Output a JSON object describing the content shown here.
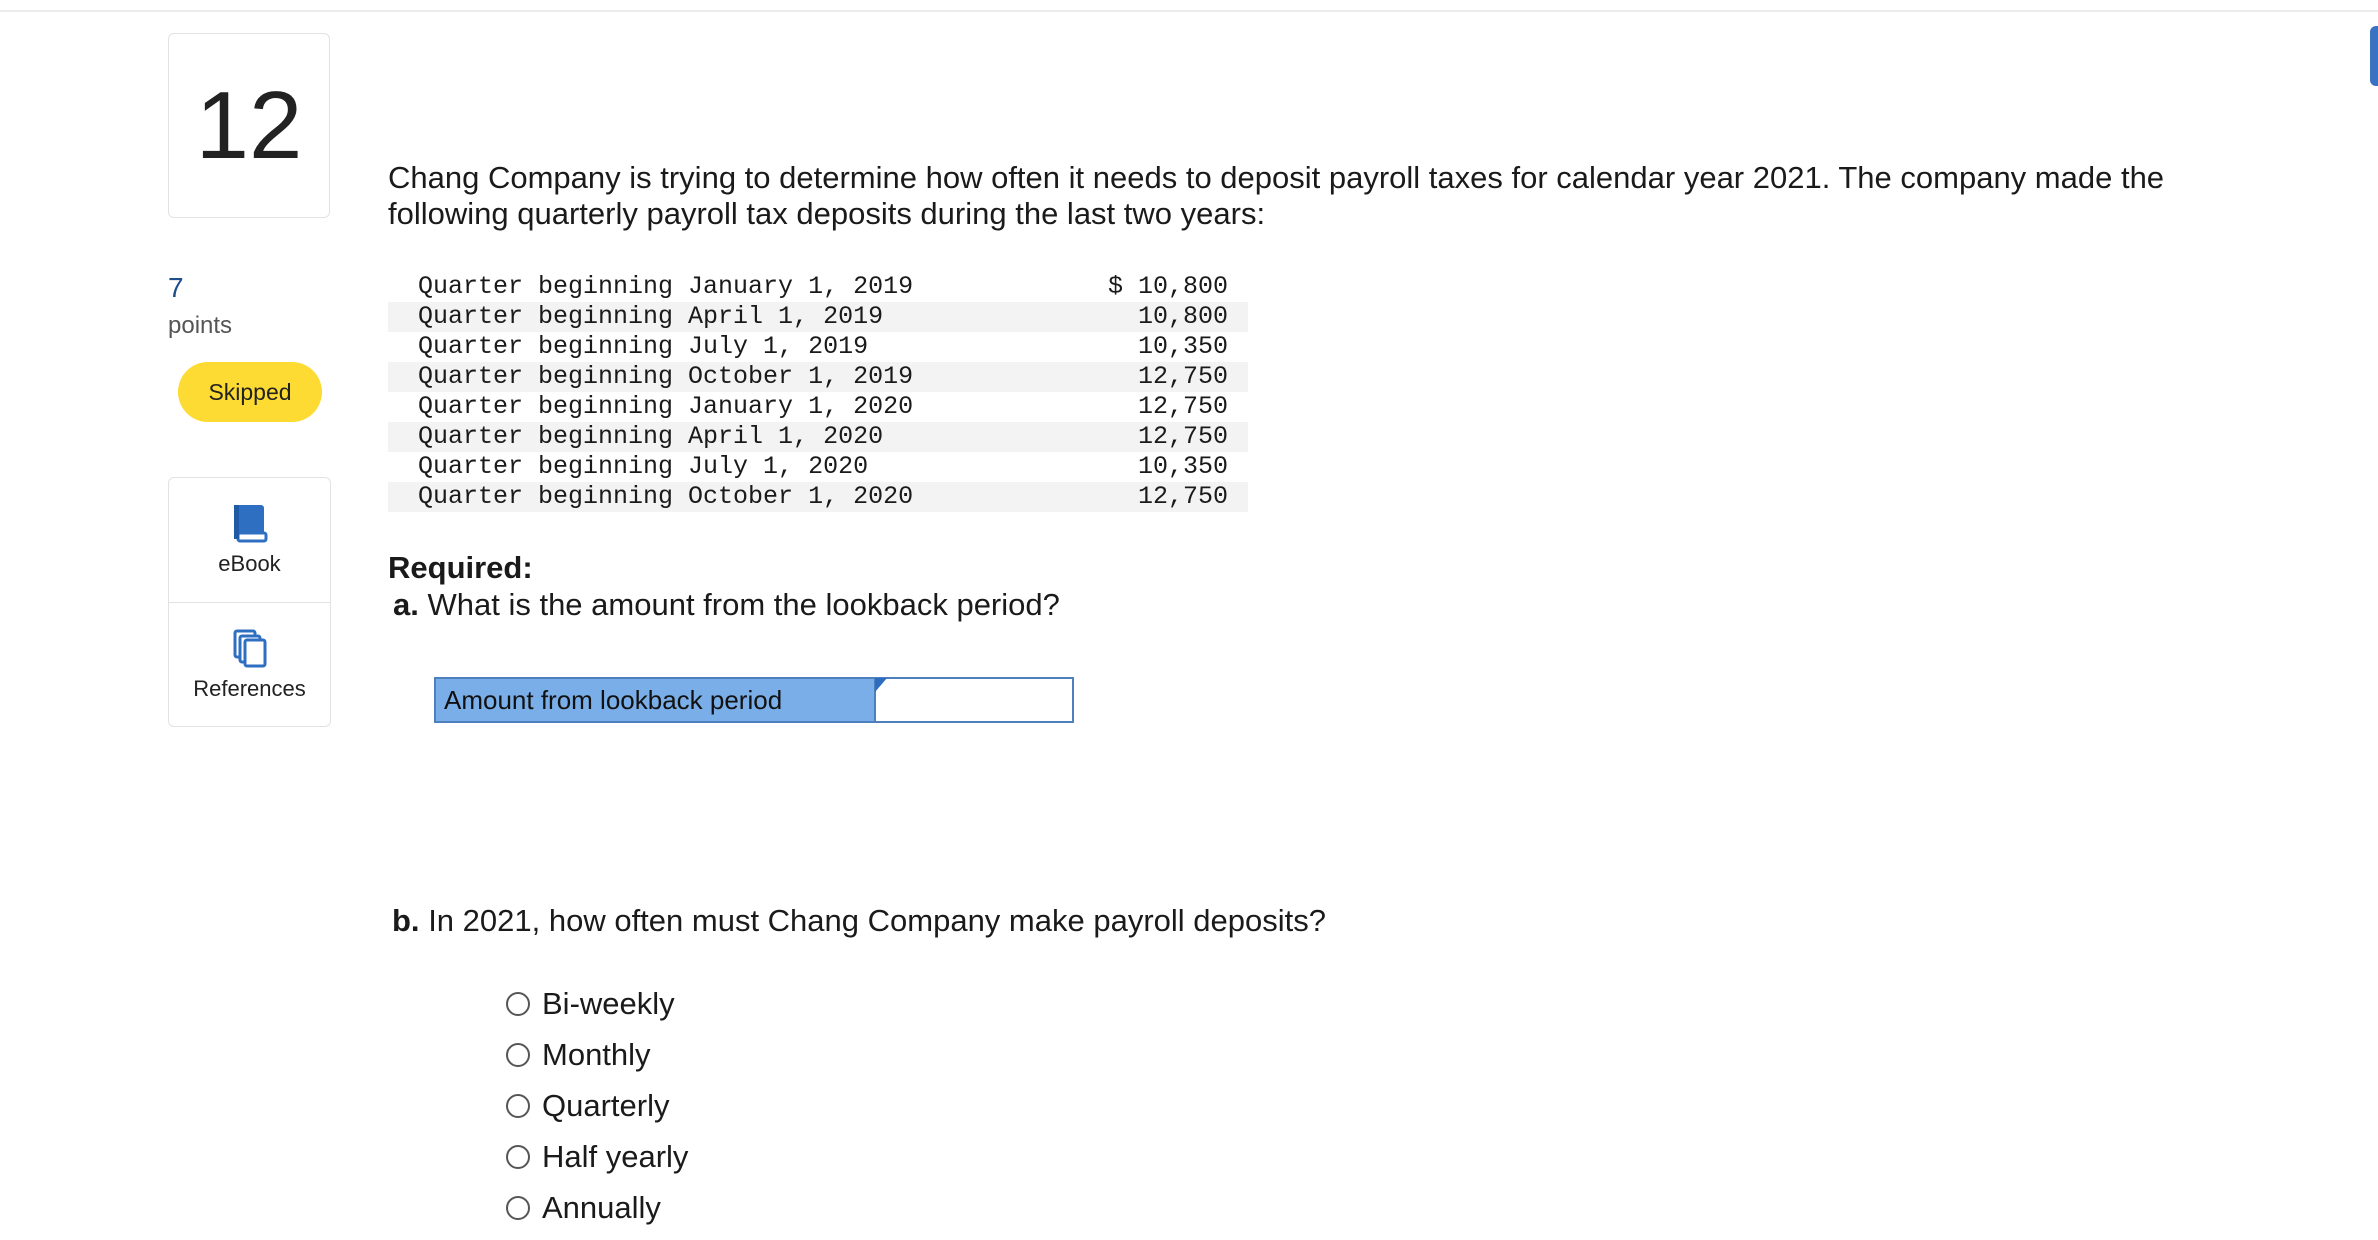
{
  "question": {
    "number": "12",
    "points_value": "7",
    "points_label": "points",
    "status": "Skipped"
  },
  "resources": [
    {
      "label": "eBook",
      "icon": "book-icon"
    },
    {
      "label": "References",
      "icon": "copy-icon"
    }
  ],
  "intro_text": "Chang Company is trying to determine how often it needs to deposit payroll taxes for calendar year 2021. The company made the following quarterly payroll tax deposits during the last two years:",
  "deposits": [
    {
      "label": "Quarter beginning January 1, 2019",
      "amount": "$ 10,800"
    },
    {
      "label": "Quarter beginning April 1, 2019",
      "amount": "10,800"
    },
    {
      "label": "Quarter beginning July 1, 2019",
      "amount": "10,350"
    },
    {
      "label": "Quarter beginning October 1, 2019",
      "amount": "12,750"
    },
    {
      "label": "Quarter beginning January 1, 2020",
      "amount": "12,750"
    },
    {
      "label": "Quarter beginning April 1, 2020",
      "amount": "12,750"
    },
    {
      "label": "Quarter beginning July 1, 2020",
      "amount": "10,350"
    },
    {
      "label": "Quarter beginning October 1, 2020",
      "amount": "12,750"
    }
  ],
  "required_heading": "Required:",
  "part_a": {
    "prefix": "a.",
    "text": "What is the amount from the lookback period?",
    "answer_label": "Amount from lookback period",
    "answer_value": ""
  },
  "part_b": {
    "prefix": "b.",
    "text": "In 2021, how often must Chang Company make payroll deposits?",
    "options": [
      "Bi-weekly",
      "Monthly",
      "Quarterly",
      "Half yearly",
      "Annually"
    ]
  },
  "colors": {
    "accent": "#1f4e8c",
    "status_badge": "#fedb32",
    "answer_label_bg": "#7aaee8",
    "answer_border": "#4e7fbf"
  }
}
